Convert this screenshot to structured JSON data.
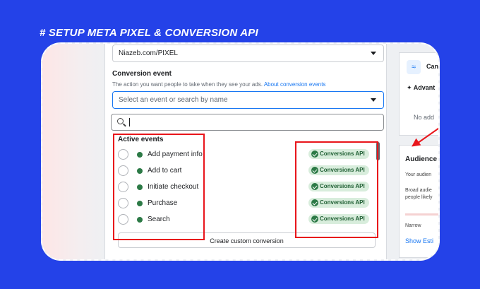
{
  "headline": "# SETUP META PIXEL & CONVERSION API",
  "pixel_select": {
    "value": "Niazeb.com/PIXEL"
  },
  "conversion_event": {
    "label": "Conversion event",
    "description": "The action you want people to take when they see your ads.",
    "link": "About conversion events",
    "placeholder": "Select an event or search by name",
    "search_value": ""
  },
  "active_events": {
    "title": "Active events",
    "items": [
      {
        "label": "Add payment info",
        "badge": "Conversions API"
      },
      {
        "label": "Add to cart",
        "badge": "Conversions API"
      },
      {
        "label": "Initiate checkout",
        "badge": "Conversions API"
      },
      {
        "label": "Purchase",
        "badge": "Conversions API"
      },
      {
        "label": "Search",
        "badge": "Conversions API"
      }
    ]
  },
  "create_custom_label": "Create custom conversion",
  "right_panel": {
    "campaign_label": "Can",
    "advantage_label": "Advant",
    "no_add_text": "No add",
    "audience_title": "Audience",
    "audience_line": "Your audien",
    "broad_line1": "Broad audie",
    "broad_line2": "people likely",
    "narrow_label": "Narrow",
    "show_link": "Show Esti"
  },
  "colors": {
    "background": "#2442e8",
    "highlight": "#e8151b",
    "badge_green": "#2c7a46",
    "link": "#1877f2"
  }
}
